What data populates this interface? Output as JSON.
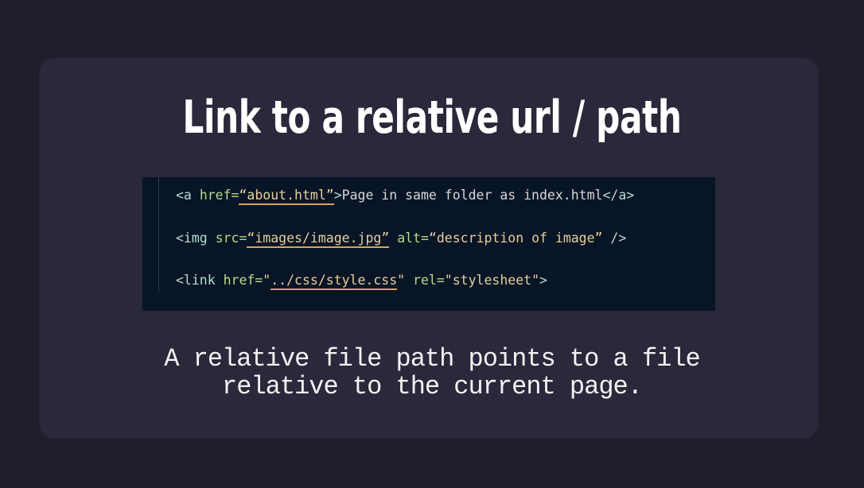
{
  "title": "Link to a relative url / path",
  "code": {
    "line1": {
      "open": "<a",
      "attr": "href=",
      "value": "“about.html”",
      "close": ">",
      "text": "Page in same folder as index.html",
      "end": "</a>"
    },
    "line2": {
      "open": "<img",
      "attr1": "src=",
      "value1": "“images/image.jpg”",
      "attr2": "alt=",
      "value2": "“description of image”",
      "end": "/>"
    },
    "line3": {
      "open": "<link",
      "attr1": "href=",
      "q1": "\"",
      "value1": "../css/style.css",
      "q2": "\"",
      "attr2": "rel=",
      "value2": "\"stylesheet\"",
      "end": ">"
    }
  },
  "caption": {
    "line1": "A relative file path points to a file",
    "line2": "relative to the current page."
  },
  "colors": {
    "background": "#1f1e2b",
    "card": "#2a283b",
    "code_background": "#081526",
    "underline": "#d9a25f"
  }
}
